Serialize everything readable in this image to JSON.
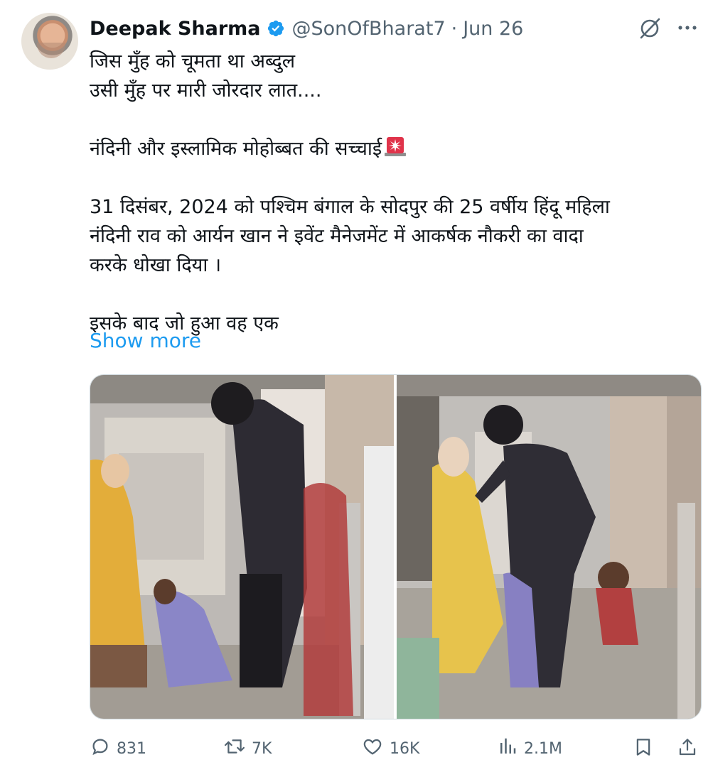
{
  "author": {
    "name": "Deepak Sharma",
    "handle": "@SonOfBharat7",
    "separator": "·",
    "date": "Jun 26",
    "verified": true
  },
  "tweet": {
    "lines": [
      "जिस मुँह को चूमता था अब्दुल",
      "उसी मुँह पर मारी जोरदार लात....",
      "",
      "नंदिनी और इस्लामिक मोहोब्बत की सच्चाई",
      "",
      "31 दिसंबर, 2024 को पश्चिम बंगाल के सोदपुर की 25 वर्षीय हिंदू महिला",
      "नंदिनी राव को आर्यन खान ने इवेंट मैनेजमेंट में आकर्षक नौकरी का वादा",
      "करके धोखा दिया  ।",
      "",
      "इसके बाद जो हुआ वह एक"
    ],
    "emoji": "rotating-light-icon",
    "show_more": "Show more"
  },
  "actions": {
    "replies": "831",
    "reposts": "7K",
    "likes": "16K",
    "views": "2.1M"
  },
  "colors": {
    "text": "#0f1419",
    "secondary": "#536471",
    "link": "#1d9bf0",
    "verified": "#1d9bf0",
    "border": "#cfd9de"
  },
  "icons": [
    "grok-icon",
    "more-icon",
    "verified-badge-icon",
    "reply-icon",
    "repost-icon",
    "like-icon",
    "views-icon",
    "bookmark-icon",
    "share-icon"
  ]
}
